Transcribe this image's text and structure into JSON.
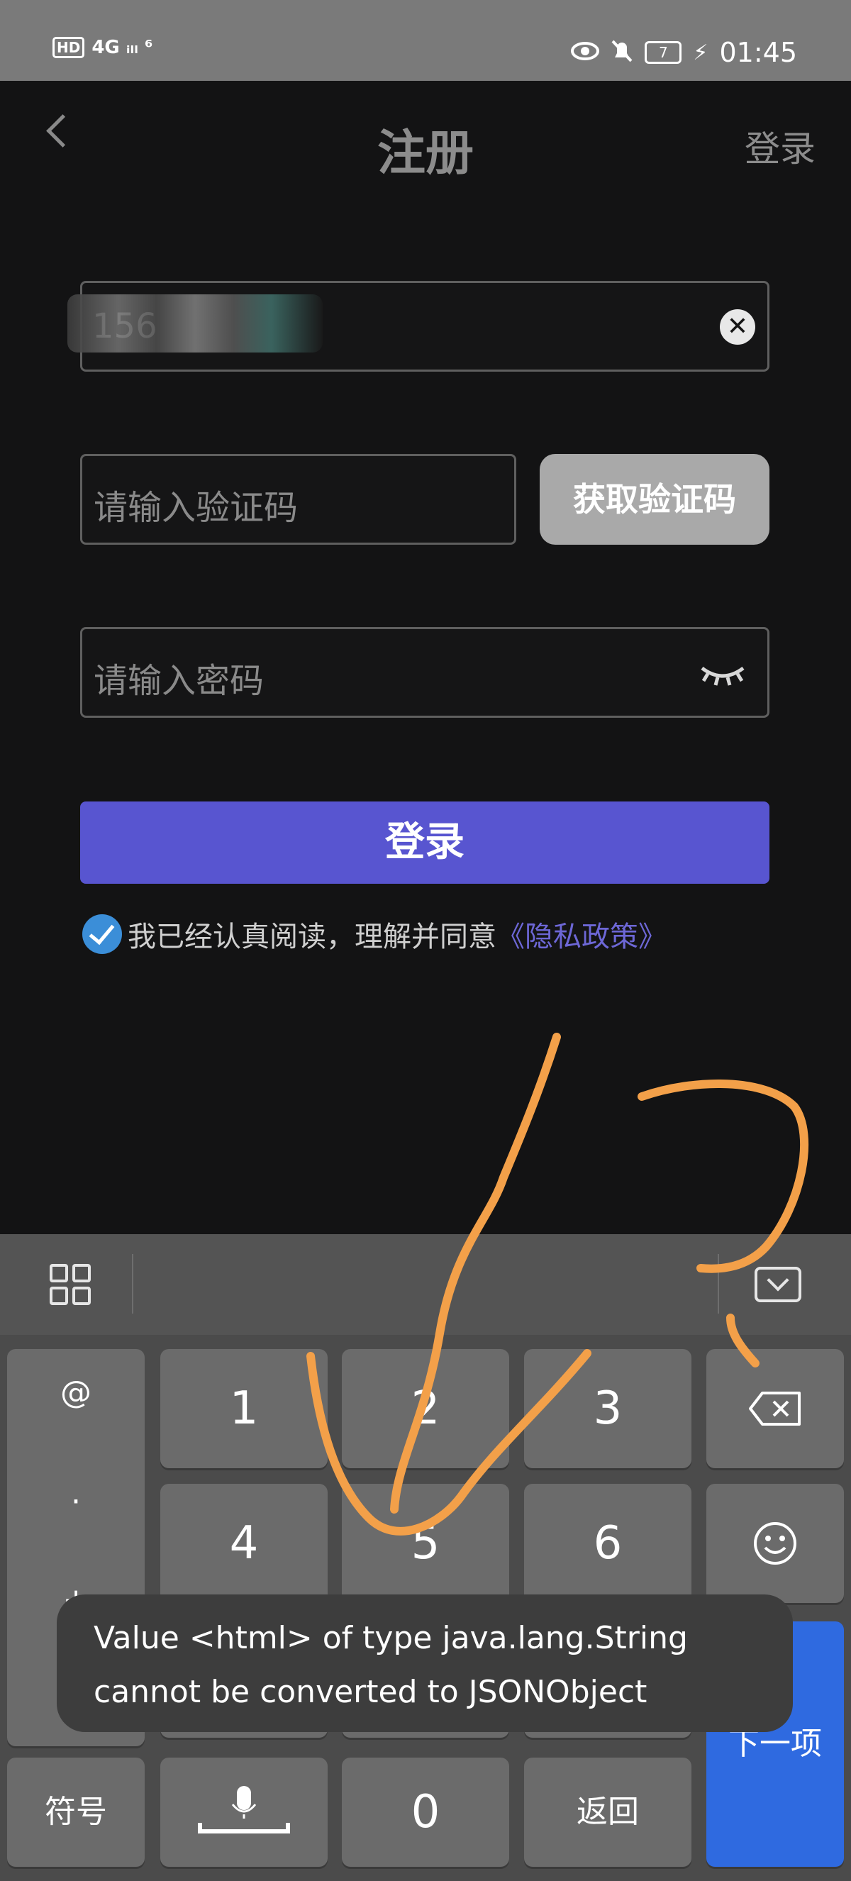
{
  "status_bar": {
    "left_indicators": "4G ᵢₗₗ ⁶",
    "time": "01:45",
    "battery": "7"
  },
  "header": {
    "title": "注册",
    "login_link": "登录"
  },
  "form": {
    "phone_value": "156",
    "clear_icon": "✕",
    "code_placeholder": "请输入验证码",
    "get_code_label": "获取验证码",
    "password_placeholder": "请输入密码",
    "login_button": "登录",
    "agreement_text": "我已经认真阅读，理解并同意",
    "policy_link": "《隐私政策》"
  },
  "keyboard": {
    "symbols": [
      "@",
      "·",
      "+"
    ],
    "keys": [
      "1",
      "2",
      "3",
      "4",
      "5",
      "6",
      "0"
    ],
    "symbol_key": "符号",
    "back_key": "返回",
    "next_key": "下一项"
  },
  "toast": {
    "line1": "Value <html> of type java.lang.String",
    "line2": "cannot be converted to JSONObject"
  },
  "colors": {
    "background": "#131314",
    "primary_button": "#5855d0",
    "policy_link": "#6d67d6",
    "annotation": "#f3a049",
    "keyboard_next": "#2f6ae0"
  }
}
